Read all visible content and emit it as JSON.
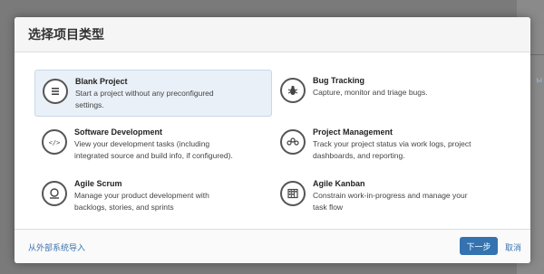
{
  "background": {
    "side_link": "ы"
  },
  "dialog": {
    "title": "选择项目类型",
    "items": [
      {
        "name": "Blank Project",
        "desc_line1": "Start a project without any preconfigured",
        "desc_line2": "settings.",
        "icon": "list-icon",
        "selected": true
      },
      {
        "name": "Bug Tracking",
        "desc_line1": "Capture, monitor and triage bugs.",
        "desc_line2": "",
        "icon": "bug-icon",
        "selected": false
      },
      {
        "name": "Software Development",
        "desc_line1": "View your development tasks (including",
        "desc_line2": "integrated source and build info, if configured).",
        "icon": "code-icon",
        "selected": false
      },
      {
        "name": "Project Management",
        "desc_line1": "Track your project status via work logs, project",
        "desc_line2": "dashboards, and reporting.",
        "icon": "people-icon",
        "selected": false
      },
      {
        "name": "Agile Scrum",
        "desc_line1": "Manage your product development with",
        "desc_line2": "backlogs, stories, and sprints",
        "icon": "magnifier-icon",
        "selected": false
      },
      {
        "name": "Agile Kanban",
        "desc_line1": "Constrain work-in-progress and manage your",
        "desc_line2": "task flow",
        "icon": "kanban-icon",
        "selected": false
      }
    ],
    "footer": {
      "import_link": "从外部系统导入",
      "next_label": "下一步",
      "cancel_label": "取消"
    }
  },
  "colors": {
    "primary": "#3572b0",
    "link": "#3b73af",
    "selected_bg": "#e9f0f8"
  }
}
